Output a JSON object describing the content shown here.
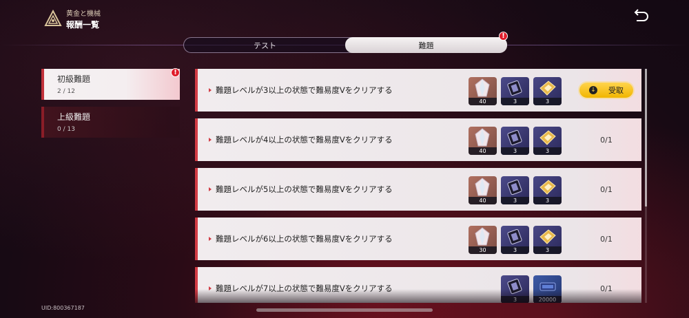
{
  "header": {
    "subtitle": "黄金と機械",
    "title": "報酬一覧"
  },
  "tabs": [
    {
      "label": "テスト",
      "active": false
    },
    {
      "label": "難題",
      "active": true,
      "alert": true
    }
  ],
  "sidebar": {
    "items": [
      {
        "label": "初級難題",
        "count": "2 / 12",
        "active": true,
        "alert": true
      },
      {
        "label": "上級難題",
        "count": "0 / 13",
        "active": false
      }
    ]
  },
  "uid": "UID:800367187",
  "alert_glyph": "!",
  "claim_icon_glyph": "↓",
  "rewards": [
    {
      "text": "難題レベルが3以上の状態で難易度Vをクリアする",
      "items": [
        {
          "icon": "crystal-icon",
          "qty": "40"
        },
        {
          "icon": "chip-icon",
          "qty": "3"
        },
        {
          "icon": "ticket-icon",
          "qty": "3"
        }
      ],
      "status": "claim",
      "claim_label": "受取"
    },
    {
      "text": "難題レベルが4以上の状態で難易度Vをクリアする",
      "items": [
        {
          "icon": "crystal-icon",
          "qty": "40"
        },
        {
          "icon": "chip-icon",
          "qty": "3"
        },
        {
          "icon": "ticket-icon",
          "qty": "3"
        }
      ],
      "status": "progress",
      "progress": "0/1"
    },
    {
      "text": "難題レベルが5以上の状態で難易度Vをクリアする",
      "items": [
        {
          "icon": "crystal-icon",
          "qty": "40"
        },
        {
          "icon": "chip-icon",
          "qty": "3"
        },
        {
          "icon": "ticket-icon",
          "qty": "3"
        }
      ],
      "status": "progress",
      "progress": "0/1"
    },
    {
      "text": "難題レベルが6以上の状態で難易度Vをクリアする",
      "items": [
        {
          "icon": "crystal-icon",
          "qty": "30"
        },
        {
          "icon": "chip-icon",
          "qty": "3"
        },
        {
          "icon": "ticket-icon",
          "qty": "3"
        }
      ],
      "status": "progress",
      "progress": "0/1"
    },
    {
      "text": "難題レベルが7以上の状態で難易度Vをクリアする",
      "items": [
        {
          "icon": "chip-icon",
          "qty": "3"
        },
        {
          "icon": "coin-icon",
          "qty": "20000"
        }
      ],
      "status": "progress",
      "progress": "0/1"
    }
  ],
  "colors": {
    "accent_red": "#d23c45",
    "claim_yellow": "#f1b600",
    "alert_red": "#e01d2b"
  }
}
